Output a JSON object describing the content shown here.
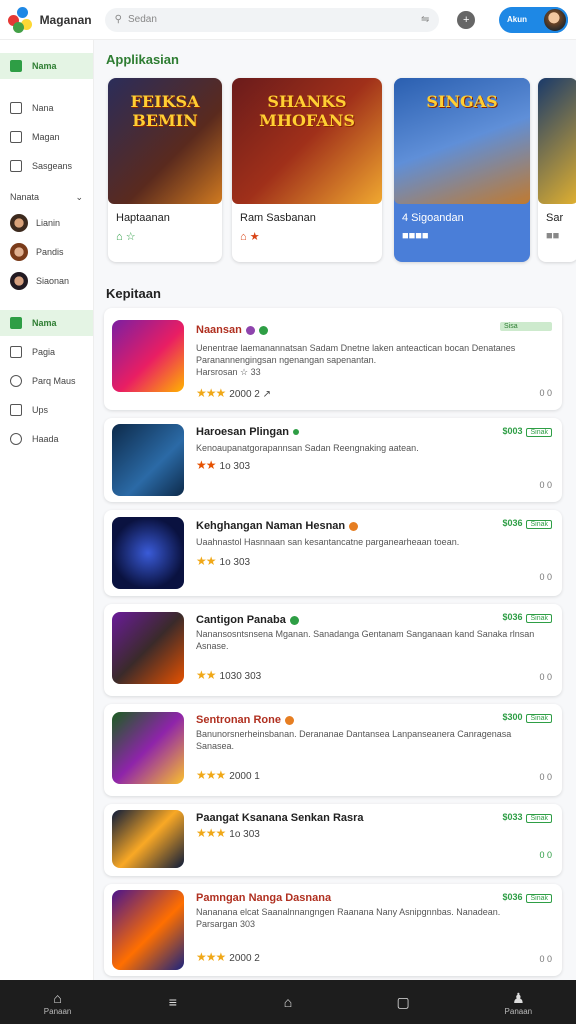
{
  "app": {
    "brand": "Maganan"
  },
  "search": {
    "placeholder": "Sedan"
  },
  "topbar": {
    "account_label": "Akun"
  },
  "sidebar": {
    "items": [
      {
        "label": "Nama",
        "active": true
      },
      {
        "label": "Nana",
        "active": false
      },
      {
        "label": "Magan",
        "active": false
      },
      {
        "label": "Sasgeans",
        "active": false
      }
    ],
    "section": "Nanata",
    "people": [
      {
        "label": "Lianin"
      },
      {
        "label": "Pandis"
      },
      {
        "label": "Siaonan"
      }
    ],
    "items2": [
      {
        "label": "Nama",
        "active": true
      },
      {
        "label": "Pagia",
        "active": false
      },
      {
        "label": "Parq Maus",
        "active": false
      },
      {
        "label": "Ups",
        "active": false
      },
      {
        "label": "Haada",
        "active": false
      }
    ]
  },
  "featured": {
    "title": "Applikasian",
    "cards": [
      {
        "art_text": "FEIKSA\nBEMIN",
        "title": "Haptaanan",
        "ic": "⌂ ☆"
      },
      {
        "art_text": "SHANKS\nMHOFANS",
        "title": "Ram Sasbanan",
        "ic": "⌂ ★"
      },
      {
        "art_text": "SINGAS",
        "title": "4 Sigoandan",
        "ic": "■■■■"
      },
      {
        "art_text": "",
        "title": "Sar",
        "ic": "■■"
      }
    ]
  },
  "list": {
    "title": "Kepitaan",
    "items": [
      {
        "title": "Naansan",
        "desc": "Uenentrae laemanannatsan Sadam Dnetne laken anteactican bocan Denatanes Paranannengingsan ngenangan sapenantan.",
        "extra": "Harsrosan ☆ 33",
        "stars": "★★★",
        "rating": "2000 2 ↗",
        "price": "",
        "pill": "Sisa",
        "side": "0 0"
      },
      {
        "title": "Haroesan Plingan",
        "desc": "Kenoaupanatgorapannsan Sadan Reengnaking aatean.",
        "extra": "",
        "stars": "★★",
        "rating": "1o 303",
        "price": "$003",
        "pill": "Sinak",
        "side": "0 0"
      },
      {
        "title": "Kehghangan Naman Hesnan",
        "desc": "Uaahnastol Hasnnaan san kesantancatne parganearheaan toean.",
        "extra": "",
        "stars": "★★",
        "rating": "1o 303",
        "price": "$036",
        "pill": "Sinak",
        "side": "0 0"
      },
      {
        "title": "Cantigon Panaba",
        "desc": "Nanansosntsnsena Mganan. Sanadanga Gentanam Sanganaan kand Sanaka rlnsan Asnase.",
        "extra": "",
        "stars": "★★",
        "rating": "1030 303",
        "price": "$036",
        "pill": "Sinak",
        "side": "0 0"
      },
      {
        "title": "Sentronan Rone",
        "desc": "Banunorsnerheinsbanan. Derananae Dantansea Lanpanseanera Canragenasa Sanasea.",
        "extra": "",
        "stars": "★★★",
        "rating": "2000 1",
        "price": "$300",
        "pill": "Sinak",
        "side": "0 0"
      },
      {
        "title": "Paangat Ksanana Senkan Rasra",
        "desc": "",
        "extra": "",
        "stars": "★★★",
        "rating": "1o 303",
        "price": "$033",
        "pill": "Sinak",
        "side": "0 0"
      },
      {
        "title": "Pamngan Nanga Dasnana",
        "desc": "Nananana elcat Saanalnnangngen Raanana Nany Asnipgnnbas. Nanadean.",
        "extra": "Parsargan 303",
        "stars": "★★★",
        "rating": "2000 2",
        "price": "$036",
        "pill": "Sinak",
        "side": "0 0"
      }
    ]
  },
  "bottomnav": [
    {
      "label": "Panaan",
      "icon": "⌂"
    },
    {
      "label": "",
      "icon": "≡"
    },
    {
      "label": "",
      "icon": "⌂"
    },
    {
      "label": "",
      "icon": "▢"
    },
    {
      "label": "Panaan",
      "icon": "♟"
    }
  ]
}
